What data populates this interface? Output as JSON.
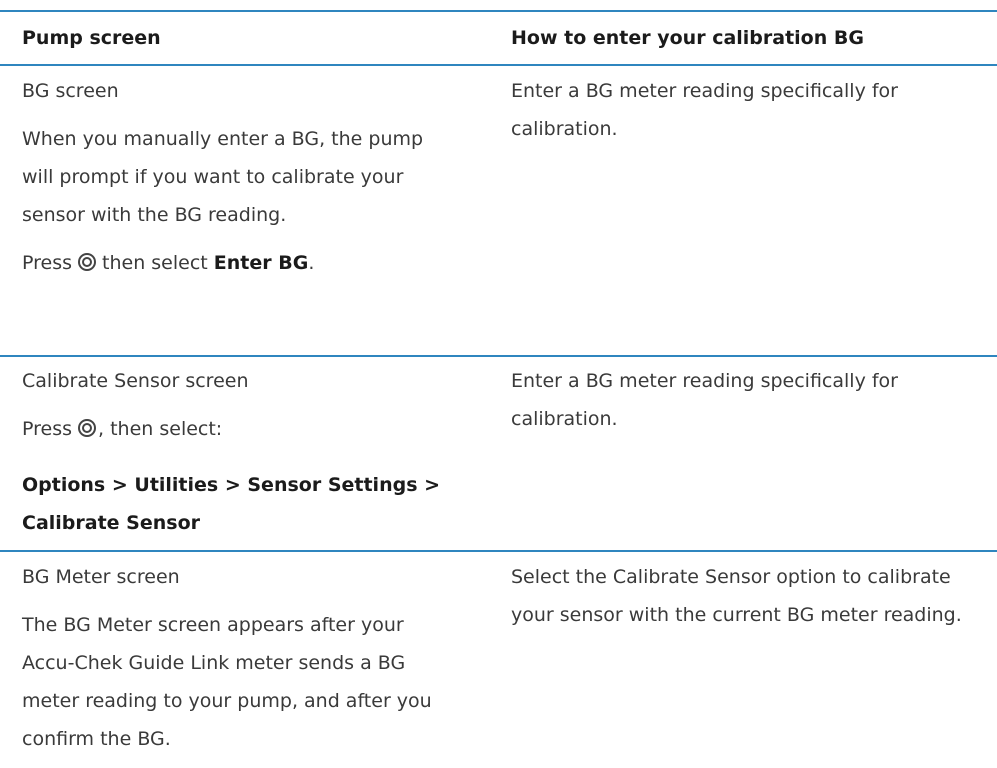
{
  "header": {
    "col1": "Pump screen",
    "col2": "How to enter your calibration BG"
  },
  "rows": [
    {
      "col1_title": "BG screen",
      "col1_desc": "When you manually enter a BG, the pump will prompt if you want to calibrate your sensor with the BG reading.",
      "col1_press_prefix": "Press",
      "col1_press_mid": "then select",
      "col1_press_bold": "Enter BG",
      "col1_press_suffix": ".",
      "col2": "Enter a BG meter reading specifically for calibration."
    },
    {
      "col1_title": "Calibrate Sensor screen",
      "col1_press_prefix": "Press",
      "col1_press_suffix": ", then select:",
      "col1_path": "Options > Utilities > Sensor Settings > Calibrate Sensor",
      "col2": "Enter a BG meter reading specifically for calibration."
    },
    {
      "col1_title": "BG Meter screen",
      "col1_desc": "The BG Meter screen appears after your Accu-Chek Guide Link meter sends a BG meter reading to your pump, and after you confirm the BG.",
      "col2": "Select the Calibrate Sensor option to calibrate your sensor with the current BG meter reading."
    }
  ],
  "colors": {
    "rule": "#2f86bf"
  },
  "icons": {
    "select_button": "select-button-icon"
  }
}
